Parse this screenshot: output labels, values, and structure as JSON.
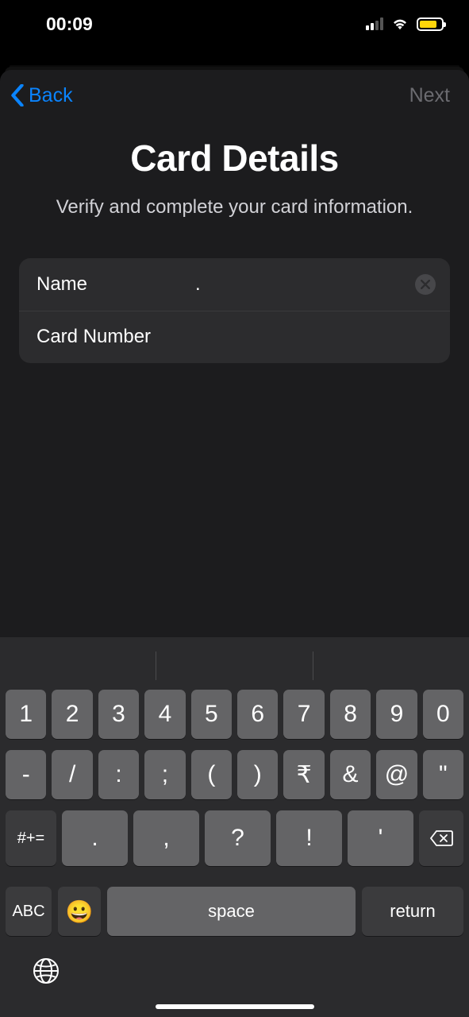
{
  "status": {
    "time": "00:09"
  },
  "nav": {
    "back": "Back",
    "next": "Next"
  },
  "page": {
    "title": "Card Details",
    "subtitle": "Verify and complete your card information."
  },
  "form": {
    "name_label": "Name",
    "name_value": ".",
    "card_number_label": "Card Number",
    "card_number_value": ""
  },
  "keyboard": {
    "row1": [
      "1",
      "2",
      "3",
      "4",
      "5",
      "6",
      "7",
      "8",
      "9",
      "0"
    ],
    "row2": [
      "-",
      "/",
      ":",
      ";",
      "(",
      ")",
      "₹",
      "&",
      "@",
      "\""
    ],
    "row3_sym": "#+=",
    "row3_punct": [
      ".",
      ",",
      "?",
      "!",
      "'"
    ],
    "abc": "ABC",
    "space": "space",
    "return": "return"
  }
}
